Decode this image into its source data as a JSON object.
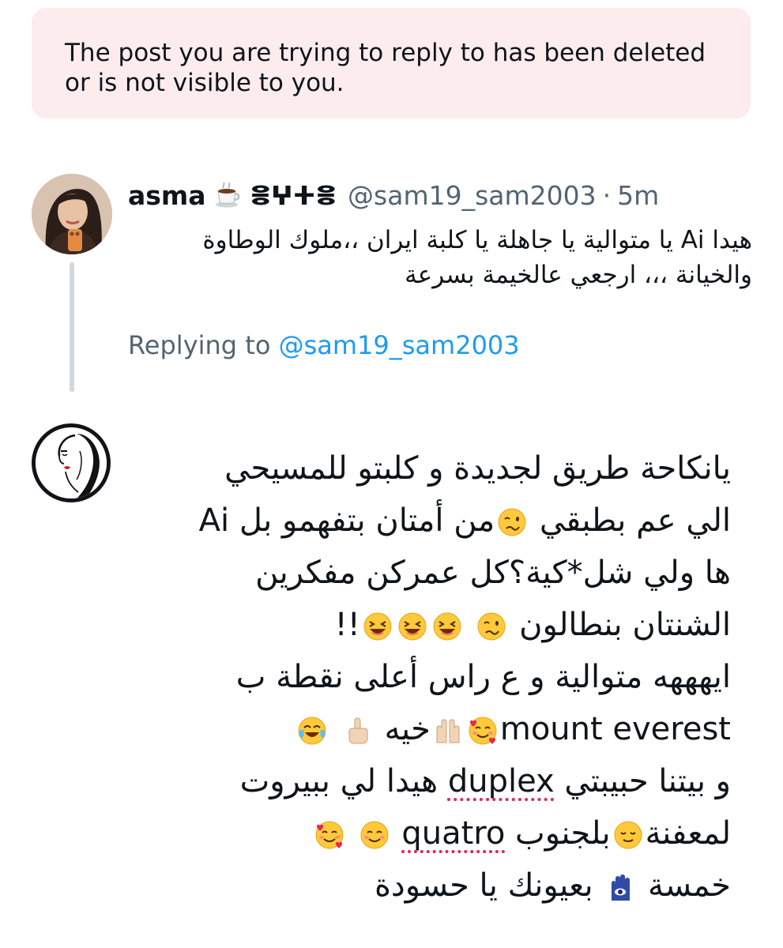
{
  "notice": {
    "text": "The post you are trying to reply to has been deleted or is not visible to you."
  },
  "parent_post": {
    "author_name": "asma",
    "name_emoji": "hot-beverage-icon",
    "name_tifinagh": "ⴻⵖⵜⴻ",
    "handle": "@sam19_sam2003",
    "separator": "·",
    "time": "5m",
    "text": "هيدا Ai يا متوالية يا جاهلة يا كلبة ايران ،،ملوك الوطاوة والخيانة ،،، ارجعي عالخيمة بسرعة"
  },
  "replying": {
    "prefix": "Replying to ",
    "mention": "@sam19_sam2003"
  },
  "reply": {
    "lines": [
      {
        "parts": [
          {
            "t": "text",
            "v": "يانكاحة طريق لجديدة و كلبتو للمسيحي"
          }
        ]
      },
      {
        "parts": [
          {
            "t": "text",
            "v": "الي عم بطبقي "
          },
          {
            "t": "emoji",
            "v": "woozy-face-icon"
          },
          {
            "t": "text",
            "v": "من أمتان بتفهمو بل Ai"
          }
        ]
      },
      {
        "parts": [
          {
            "t": "text",
            "v": "ها ولي شل*كية؟كل عمركن مفكرين"
          }
        ]
      },
      {
        "parts": [
          {
            "t": "text",
            "v": "الشنتان بنطالون "
          },
          {
            "t": "emoji",
            "v": "woozy-face-icon"
          },
          {
            "t": "text",
            "v": " "
          },
          {
            "t": "emoji",
            "v": "laughing-face-icon"
          },
          {
            "t": "emoji",
            "v": "laughing-face-icon"
          },
          {
            "t": "emoji",
            "v": "laughing-face-icon"
          },
          {
            "t": "text",
            "v": "!!"
          }
        ]
      },
      {
        "parts": [
          {
            "t": "text",
            "v": "ايهههه متوالية و ع راس أعلى نقطة ب"
          }
        ]
      },
      {
        "parts": [
          {
            "t": "ltr",
            "v": "mount everest"
          },
          {
            "t": "emoji",
            "v": "smiling-face-with-hearts-icon"
          },
          {
            "t": "emoji",
            "v": "raised-hands-icon"
          },
          {
            "t": "text",
            "v": "خيه "
          },
          {
            "t": "emoji",
            "v": "middle-finger-icon"
          },
          {
            "t": "text",
            "v": " "
          },
          {
            "t": "emoji",
            "v": "tears-of-joy-icon"
          }
        ]
      },
      {
        "parts": [
          {
            "t": "text",
            "v": "و بيتنا حبيبتي "
          },
          {
            "t": "ltr-spell",
            "v": "duplex"
          },
          {
            "t": "text",
            "v": " هيدا لي ببيروت"
          }
        ]
      },
      {
        "parts": [
          {
            "t": "text",
            "v": "لمعفنة"
          },
          {
            "t": "emoji",
            "v": "relieved-face-icon"
          },
          {
            "t": "text",
            "v": "بلجنوب "
          },
          {
            "t": "ltr-spell",
            "v": "quatro"
          },
          {
            "t": "text",
            "v": " "
          },
          {
            "t": "emoji",
            "v": "smiling-face-icon"
          },
          {
            "t": "text",
            "v": " "
          },
          {
            "t": "emoji",
            "v": "smiling-face-with-hearts-icon"
          }
        ]
      },
      {
        "parts": [
          {
            "t": "text",
            "v": "خمسة "
          },
          {
            "t": "emoji",
            "v": "hamsa-icon"
          },
          {
            "t": "text",
            "v": " بعيونك يا حسودة"
          }
        ]
      }
    ]
  }
}
